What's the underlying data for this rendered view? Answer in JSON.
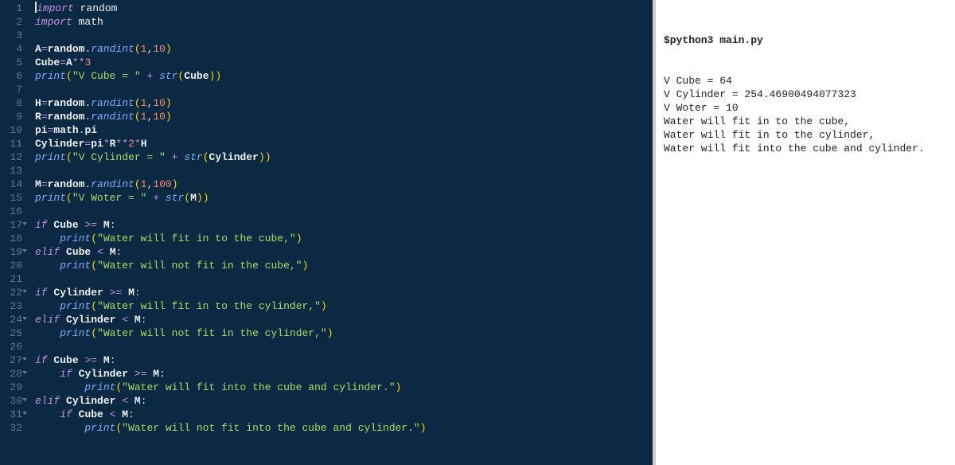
{
  "editor": {
    "lines": [
      {
        "n": 1,
        "fold": false,
        "html": "<span class='cursor'></span><span class='kw'>import</span> <span class='mod'>random</span>"
      },
      {
        "n": 2,
        "fold": false,
        "html": "<span class='kw'>import</span> <span class='mod'>math</span>"
      },
      {
        "n": 3,
        "fold": false,
        "html": ""
      },
      {
        "n": 4,
        "fold": false,
        "html": "<span class='var'>A</span><span class='op'>=</span><span class='var'>random</span>.<span class='fn'>randint</span><span class='pn'>(</span><span class='num'>1</span>,<span class='num'>10</span><span class='pn'>)</span>"
      },
      {
        "n": 5,
        "fold": false,
        "html": "<span class='var'>Cube</span><span class='op'>=</span><span class='var'>A</span><span class='op'>**</span><span class='num'>3</span>"
      },
      {
        "n": 6,
        "fold": false,
        "html": "<span class='fn'>print</span><span class='pn'>(</span><span class='str'>\"V Cube = \"</span> <span class='op'>+</span> <span class='fn'>str</span><span class='pn'>(</span><span class='var'>Cube</span><span class='pn'>))</span>"
      },
      {
        "n": 7,
        "fold": false,
        "html": ""
      },
      {
        "n": 8,
        "fold": false,
        "html": "<span class='var'>H</span><span class='op'>=</span><span class='var'>random</span>.<span class='fn'>randint</span><span class='pn'>(</span><span class='num'>1</span>,<span class='num'>10</span><span class='pn'>)</span>"
      },
      {
        "n": 9,
        "fold": false,
        "html": "<span class='var'>R</span><span class='op'>=</span><span class='var'>random</span>.<span class='fn'>randint</span><span class='pn'>(</span><span class='num'>1</span>,<span class='num'>10</span><span class='pn'>)</span>"
      },
      {
        "n": 10,
        "fold": false,
        "html": "<span class='var'>pi</span><span class='op'>=</span><span class='var'>math</span>.<span class='var'>pi</span>"
      },
      {
        "n": 11,
        "fold": false,
        "html": "<span class='var'>Cylinder</span><span class='op'>=</span><span class='var'>pi</span><span class='op'>*</span><span class='var'>R</span><span class='op'>**</span><span class='num'>2</span><span class='op'>*</span><span class='var'>H</span>"
      },
      {
        "n": 12,
        "fold": false,
        "html": "<span class='fn'>print</span><span class='pn'>(</span><span class='str'>\"V Cylinder = \"</span> <span class='op'>+</span> <span class='fn'>str</span><span class='pn'>(</span><span class='var'>Cylinder</span><span class='pn'>))</span>"
      },
      {
        "n": 13,
        "fold": false,
        "html": ""
      },
      {
        "n": 14,
        "fold": false,
        "html": "<span class='var'>M</span><span class='op'>=</span><span class='var'>random</span>.<span class='fn'>randint</span><span class='pn'>(</span><span class='num'>1</span>,<span class='num'>100</span><span class='pn'>)</span>"
      },
      {
        "n": 15,
        "fold": false,
        "html": "<span class='fn'>print</span><span class='pn'>(</span><span class='str'>\"V Woter = \"</span> <span class='op'>+</span> <span class='fn'>str</span><span class='pn'>(</span><span class='var'>M</span><span class='pn'>))</span>"
      },
      {
        "n": 16,
        "fold": false,
        "html": ""
      },
      {
        "n": 17,
        "fold": true,
        "html": "<span class='kw'>if</span> <span class='var'>Cube</span> <span class='op'>&gt;=</span> <span class='var'>M</span>:"
      },
      {
        "n": 18,
        "fold": false,
        "html": "    <span class='fn'>print</span><span class='pn'>(</span><span class='str'>\"Water will fit in to the cube,\"</span><span class='pn'>)</span>"
      },
      {
        "n": 19,
        "fold": true,
        "html": "<span class='kw'>elif</span> <span class='var'>Cube</span> <span class='op'>&lt;</span> <span class='var'>M</span>:"
      },
      {
        "n": 20,
        "fold": false,
        "html": "    <span class='fn'>print</span><span class='pn'>(</span><span class='str'>\"Water will not fit in the cube,\"</span><span class='pn'>)</span>"
      },
      {
        "n": 21,
        "fold": false,
        "html": ""
      },
      {
        "n": 22,
        "fold": true,
        "html": "<span class='kw'>if</span> <span class='var'>Cylinder</span> <span class='op'>&gt;=</span> <span class='var'>M</span>:"
      },
      {
        "n": 23,
        "fold": false,
        "html": "    <span class='fn'>print</span><span class='pn'>(</span><span class='str'>\"Water will fit in to the cylinder,\"</span><span class='pn'>)</span>"
      },
      {
        "n": 24,
        "fold": true,
        "html": "<span class='kw'>elif</span> <span class='var'>Cylinder</span> <span class='op'>&lt;</span> <span class='var'>M</span>:"
      },
      {
        "n": 25,
        "fold": false,
        "html": "    <span class='fn'>print</span><span class='pn'>(</span><span class='str'>\"Water will not fit in the cylinder,\"</span><span class='pn'>)</span>"
      },
      {
        "n": 26,
        "fold": false,
        "html": ""
      },
      {
        "n": 27,
        "fold": true,
        "html": "<span class='kw'>if</span> <span class='var'>Cube</span> <span class='op'>&gt;=</span> <span class='var'>M</span>:"
      },
      {
        "n": 28,
        "fold": true,
        "html": "    <span class='kw'>if</span> <span class='var'>Cylinder</span> <span class='op'>&gt;=</span> <span class='var'>M</span>:"
      },
      {
        "n": 29,
        "fold": false,
        "html": "        <span class='fn'>print</span><span class='pn'>(</span><span class='str'>\"Water will fit into the cube and cylinder.\"</span><span class='pn'>)</span>"
      },
      {
        "n": 30,
        "fold": true,
        "html": "<span class='kw'>elif</span> <span class='var'>Cylinder</span> <span class='op'>&lt;</span> <span class='var'>M</span>:"
      },
      {
        "n": 31,
        "fold": true,
        "html": "    <span class='kw'>if</span> <span class='var'>Cube</span> <span class='op'>&lt;</span> <span class='var'>M</span>:"
      },
      {
        "n": 32,
        "fold": false,
        "html": "        <span class='fn'>print</span><span class='pn'>(</span><span class='str'>\"Water will not fit into the cube and cylinder.\"</span><span class='pn'>)</span>"
      }
    ]
  },
  "output": {
    "command": "$python3 main.py",
    "lines": [
      "V Cube = 64",
      "V Cylinder = 254.46900494077323",
      "V Woter = 10",
      "Water will fit in to the cube,",
      "Water will fit in to the cylinder,",
      "Water will fit into the cube and cylinder."
    ]
  }
}
